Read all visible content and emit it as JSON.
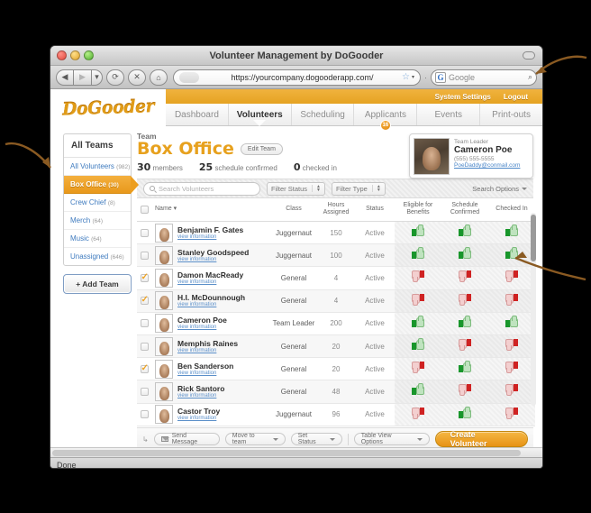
{
  "window": {
    "title": "Volunteer Management by DoGooder",
    "status": "Done"
  },
  "browser": {
    "back_icon": "◀",
    "forward_icon": "▶",
    "dropdown_icon": "▾",
    "reload_icon": "⟳",
    "stop_icon": "✕",
    "home_icon": "⌂",
    "url": "https://yourcompany.dogooderapp.com/",
    "star_icon": "☆",
    "caret_icon": "▾",
    "separator": "·",
    "search_engine": "G",
    "search_placeholder": "Google",
    "search_icon": "⌕"
  },
  "app": {
    "logo": "DoGooder",
    "utility": [
      {
        "label": "System Settings"
      },
      {
        "label": "Logout"
      }
    ],
    "tabs": [
      {
        "label": "Dashboard",
        "active": false
      },
      {
        "label": "Volunteers",
        "active": true
      },
      {
        "label": "Scheduling",
        "active": false
      },
      {
        "label": "Applicants",
        "active": false,
        "badge": "16"
      },
      {
        "label": "Events",
        "active": false
      },
      {
        "label": "Print-outs",
        "active": false
      }
    ]
  },
  "sidebar": {
    "title": "All Teams",
    "items": [
      {
        "label": "All Volunteers",
        "count": "(982)",
        "selected": false
      },
      {
        "label": "Box Office",
        "count": "(30)",
        "selected": true
      },
      {
        "label": "Crew Chief",
        "count": "(8)",
        "selected": false
      },
      {
        "label": "Merch",
        "count": "(64)",
        "selected": false
      },
      {
        "label": "Music",
        "count": "(64)",
        "selected": false
      },
      {
        "label": "Unassigned",
        "count": "(646)",
        "selected": false
      }
    ],
    "add_team_label": "+ Add Team"
  },
  "team": {
    "kicker": "Team",
    "name": "Box Office",
    "edit_label": "Edit Team",
    "stats": [
      {
        "value": "30",
        "label": "members"
      },
      {
        "value": "25",
        "label": "schedule confirmed"
      },
      {
        "value": "0",
        "label": "checked in"
      }
    ]
  },
  "profile": {
    "role": "Team Leader",
    "name": "Cameron Poe",
    "phone": "(555) 555-5555",
    "email": "PoeDaddy@conmail.com"
  },
  "filters": {
    "search_placeholder": "Search Volunteers",
    "status_label": "Filter Status",
    "type_label": "Filter Type",
    "search_options_label": "Search Options"
  },
  "table": {
    "columns": [
      "",
      "Name",
      "Class",
      "Hours Assigned",
      "Status",
      "Eligible for Benefits",
      "Schedule Confirmed",
      "Checked In"
    ],
    "sort_icon": "▾",
    "view_info_label": "view information",
    "rows": [
      {
        "checked": false,
        "name": "Benjamin F. Gates",
        "class": "Juggernaut",
        "hours": "150",
        "status": "Active",
        "benefits": "up",
        "schedule": "up",
        "checkedin": "up"
      },
      {
        "checked": false,
        "name": "Stanley Goodspeed",
        "class": "Juggernaut",
        "hours": "100",
        "status": "Active",
        "benefits": "up",
        "schedule": "up",
        "checkedin": "up"
      },
      {
        "checked": true,
        "name": "Damon MacReady",
        "class": "General",
        "hours": "4",
        "status": "Active",
        "benefits": "down",
        "schedule": "down",
        "checkedin": "down"
      },
      {
        "checked": true,
        "name": "H.I. McDounnough",
        "class": "General",
        "hours": "4",
        "status": "Active",
        "benefits": "down",
        "schedule": "down",
        "checkedin": "down"
      },
      {
        "checked": false,
        "name": "Cameron Poe",
        "class": "Team Leader",
        "hours": "200",
        "status": "Active",
        "benefits": "up",
        "schedule": "up",
        "checkedin": "up"
      },
      {
        "checked": false,
        "name": "Memphis Raines",
        "class": "General",
        "hours": "20",
        "status": "Active",
        "benefits": "up",
        "schedule": "down",
        "checkedin": "down"
      },
      {
        "checked": true,
        "name": "Ben Sanderson",
        "class": "General",
        "hours": "20",
        "status": "Active",
        "benefits": "down",
        "schedule": "up",
        "checkedin": "down"
      },
      {
        "checked": false,
        "name": "Rick Santoro",
        "class": "General",
        "hours": "48",
        "status": "Active",
        "benefits": "up",
        "schedule": "down",
        "checkedin": "down"
      },
      {
        "checked": false,
        "name": "Castor Troy",
        "class": "Juggernaut",
        "hours": "96",
        "status": "Active",
        "benefits": "down",
        "schedule": "up",
        "checkedin": "down"
      }
    ]
  },
  "toolbar": {
    "send_message_label": "Send Message",
    "move_to_team_label": "Move to team",
    "set_status_label": "Set Status",
    "table_view_options_label": "Table View Options",
    "create_label": "Create Volunteer",
    "caret": "▾"
  }
}
